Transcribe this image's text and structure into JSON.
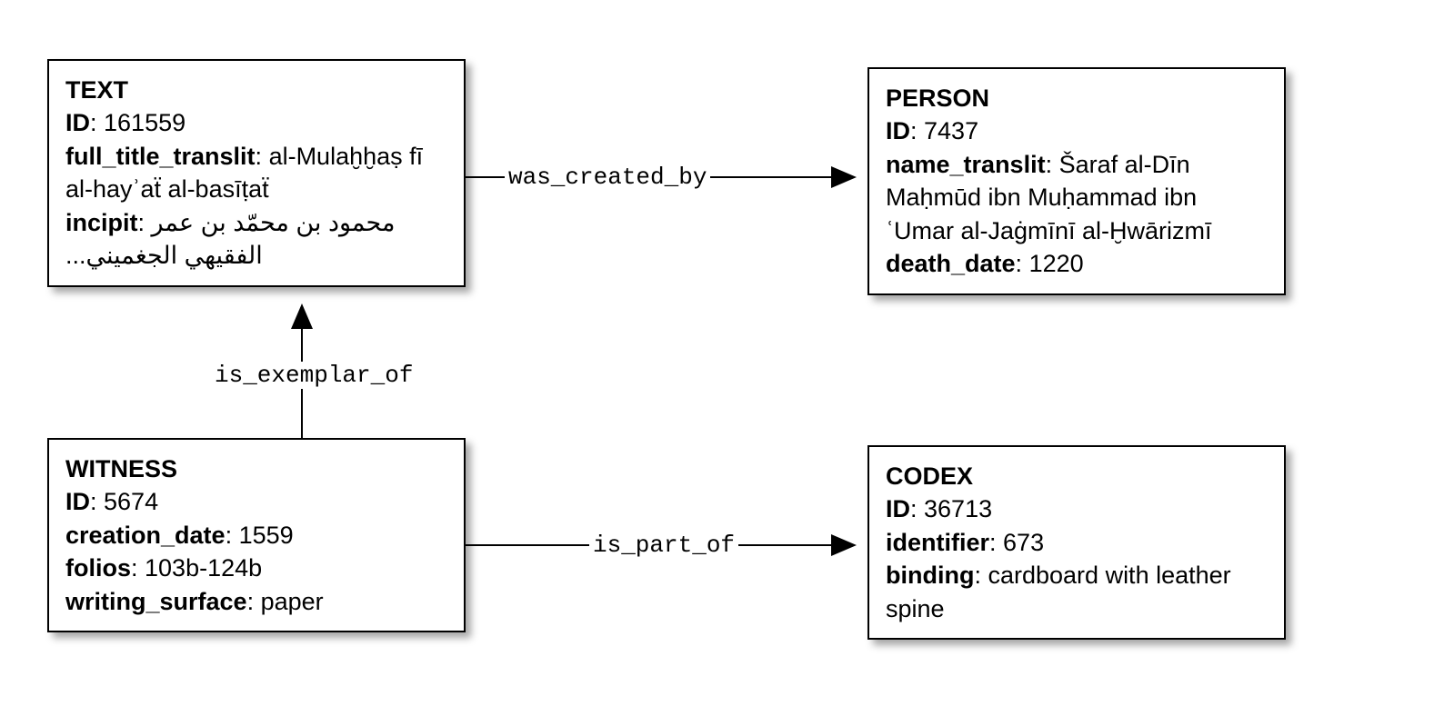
{
  "nodes": {
    "text": {
      "title": "TEXT",
      "fields": {
        "id_key": "ID",
        "id_val": "161559",
        "full_title_key": "full_title_translit",
        "full_title_val": "al-Mulaḫḫaṣ fī al-hayʾaẗ al-basīṭaẗ",
        "incipit_key": "incipit",
        "incipit_val": "محمود بن محمّد بن عمر الفقيهي الجغميني..."
      }
    },
    "person": {
      "title": "PERSON",
      "fields": {
        "id_key": "ID",
        "id_val": "7437",
        "name_key": "name_translit",
        "name_val": "Šaraf al-Dīn Maḥmūd ibn Muḥammad ibn ʿUmar al-Jaġmīnī al-Ḫwārizmī",
        "death_key": "death_date",
        "death_val": "1220"
      }
    },
    "witness": {
      "title": "WITNESS",
      "fields": {
        "id_key": "ID",
        "id_val": "5674",
        "creation_key": "creation_date",
        "creation_val": "1559",
        "folios_key": "folios",
        "folios_val": "103b-124b",
        "surface_key": "writing_surface",
        "surface_val": "paper"
      }
    },
    "codex": {
      "title": "CODEX",
      "fields": {
        "id_key": "ID",
        "id_val": "36713",
        "identifier_key": "identifier",
        "identifier_val": "673",
        "binding_key": "binding",
        "binding_val": "cardboard with leather spine"
      }
    }
  },
  "edges": {
    "was_created_by": "was_created_by",
    "is_exemplar_of": "is_exemplar_of",
    "is_part_of": "is_part_of"
  }
}
